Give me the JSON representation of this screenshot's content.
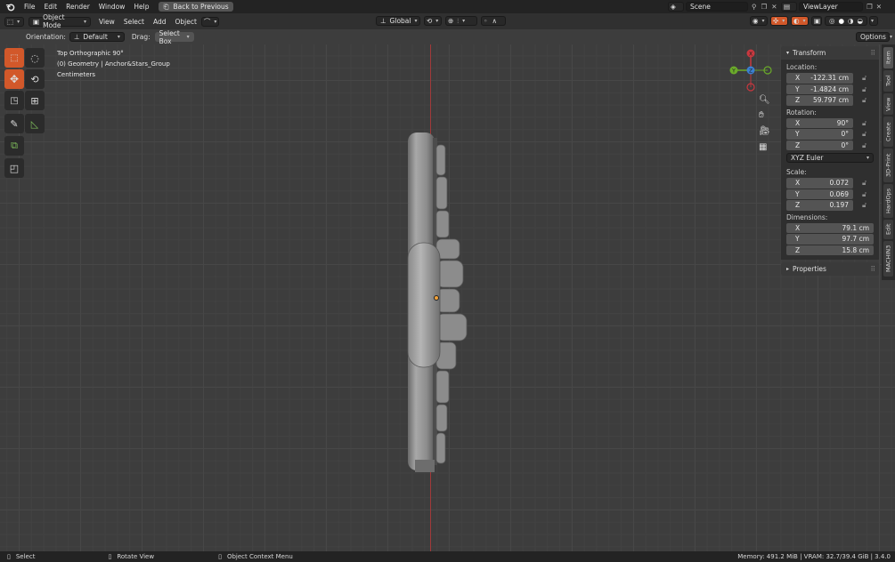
{
  "menu": {
    "items": [
      "File",
      "Edit",
      "Render",
      "Window",
      "Help"
    ],
    "back_button": "Back to Previous",
    "scene": "Scene",
    "view_layer": "ViewLayer"
  },
  "header": {
    "mode": "Object Mode",
    "view": "View",
    "select": "Select",
    "add": "Add",
    "object": "Object",
    "transform_orientation": "Global"
  },
  "header2": {
    "orientation_label": "Orientation:",
    "orientation_value": "Default",
    "drag_label": "Drag:",
    "drag_value": "Select Box",
    "options": "Options"
  },
  "viewport": {
    "view_name": "Top Orthographic 90°",
    "collection": "(0) Geometry | Anchor&Stars_Group",
    "units": "Centimeters",
    "gizmo": {
      "x": "X",
      "y": "Y",
      "z": "Z"
    }
  },
  "npanel": {
    "transform_title": "Transform",
    "location_label": "Location:",
    "location": [
      {
        "axis": "X",
        "value": "-122.31 cm"
      },
      {
        "axis": "Y",
        "value": "-1.4824 cm"
      },
      {
        "axis": "Z",
        "value": "59.797 cm"
      }
    ],
    "rotation_label": "Rotation:",
    "rotation": [
      {
        "axis": "X",
        "value": "90°"
      },
      {
        "axis": "Y",
        "value": "0°"
      },
      {
        "axis": "Z",
        "value": "0°"
      }
    ],
    "rotation_mode": "XYZ Euler",
    "scale_label": "Scale:",
    "scale": [
      {
        "axis": "X",
        "value": "0.072"
      },
      {
        "axis": "Y",
        "value": "0.069"
      },
      {
        "axis": "Z",
        "value": "0.197"
      }
    ],
    "dimensions_label": "Dimensions:",
    "dimensions": [
      {
        "axis": "X",
        "value": "79.1 cm"
      },
      {
        "axis": "Y",
        "value": "97.7 cm"
      },
      {
        "axis": "Z",
        "value": "15.8 cm"
      }
    ],
    "properties_title": "Properties"
  },
  "side_tabs": [
    "Item",
    "Tool",
    "View",
    "Create",
    "3D-Print",
    "HardOps",
    "Edit",
    "MACHIN3"
  ],
  "status": {
    "select": "Select",
    "rotate": "Rotate View",
    "context": "Object Context Menu",
    "memory": "Memory: 491.2 MiB | VRAM: 32.7/39.4 GiB | 3.4.0"
  },
  "colors": {
    "accent": "#d2582a",
    "axis_red": "#c8383f",
    "axis_green": "#6bab2a",
    "axis_blue": "#3b7fd1",
    "origin": "#f2a23a"
  }
}
